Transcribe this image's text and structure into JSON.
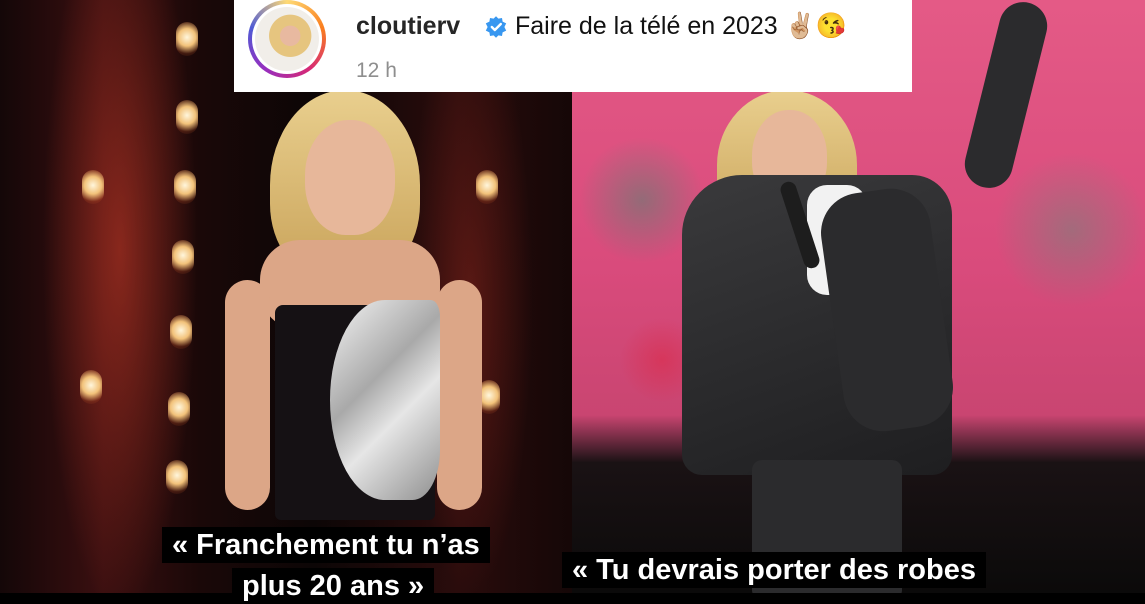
{
  "post": {
    "username": "cloutierv",
    "caption": "Faire de la télé en 2023 ✌🏼😘",
    "timestamp": "12 h"
  },
  "overlays": {
    "left_line1": "« Franchement tu n’as",
    "left_line2": "plus 20 ans »",
    "right_line1": "« Tu devrais porter des robes"
  },
  "icons": {
    "verified": "verified-badge-icon",
    "avatar": "profile-avatar"
  },
  "colors": {
    "verified_blue": "#3897f0",
    "text_primary": "#262626",
    "text_secondary": "#8e8e8e",
    "caption_background": "#000000",
    "caption_text": "#ffffff",
    "stage_pink": "#e45a86"
  }
}
